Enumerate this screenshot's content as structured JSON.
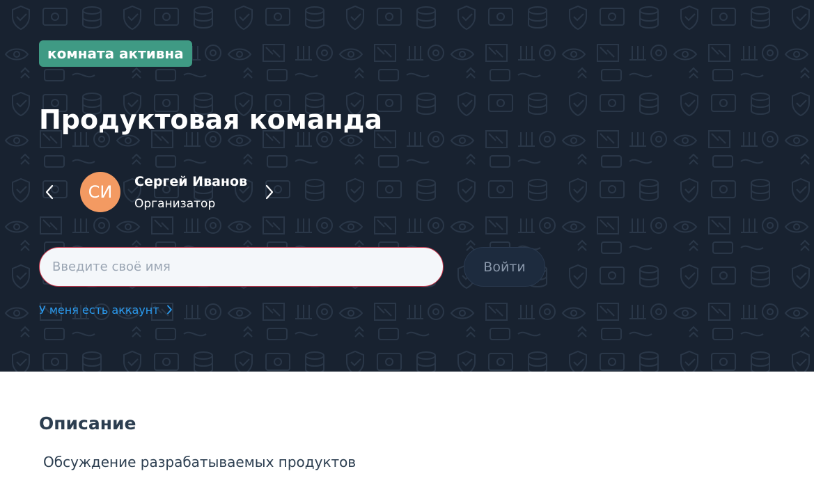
{
  "room": {
    "status_badge": "комната активна",
    "title": "Продуктовая команда"
  },
  "organizer": {
    "initials": "СИ",
    "name": "Сергей Иванов",
    "role": "Организатор"
  },
  "join_form": {
    "name_placeholder": "Введите своё имя",
    "name_value": "",
    "join_label": "Войти",
    "account_link": "У меня есть аккаунт"
  },
  "description": {
    "title": "Описание",
    "text": "Обсуждение разрабатываемых продуктов"
  },
  "icons": {
    "prev": "chevron-left-icon",
    "next": "chevron-right-icon",
    "link_chevron": "chevron-right-icon"
  },
  "colors": {
    "hero_background": "#182230",
    "badge": "#3f9a84",
    "avatar": "#f39a62",
    "input_border": "#c8344a",
    "link": "#2a9bf0",
    "heading": "#2c3e50"
  }
}
